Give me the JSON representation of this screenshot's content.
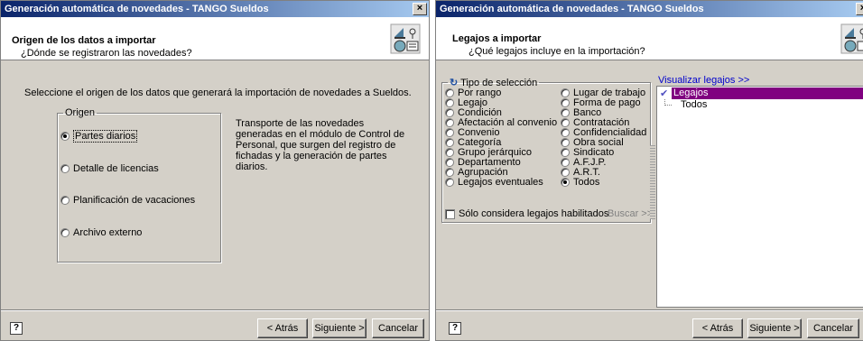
{
  "left_window": {
    "title": "Generación automática de novedades - TANGO Sueldos",
    "close_label": "×",
    "header_title": "Origen de los datos a importar",
    "header_subtitle": "¿Dónde se registraron las novedades?",
    "instruction": "Seleccione el origen de los datos que generará la importación de novedades a Sueldos.",
    "origin_group_label": "Origen",
    "origin_options": [
      {
        "label": "Partes diarios",
        "selected": true
      },
      {
        "label": "Detalle de licencias",
        "selected": false
      },
      {
        "label": "Planificación de vacaciones",
        "selected": false
      },
      {
        "label": "Archivo externo",
        "selected": false
      }
    ],
    "description": "Transporte de las novedades generadas en el módulo de Control de Personal, que surgen del registro de fichadas y la generación de partes diarios.",
    "help_label": "?",
    "buttons": {
      "back": "< Atrás",
      "next": "Siguiente >",
      "cancel": "Cancelar"
    }
  },
  "right_window": {
    "title": "Generación automática de novedades - TANGO Sueldos",
    "header_title": "Legajos a importar",
    "header_subtitle": "¿Qué legajos incluye en la importación?",
    "selection_group_label": "Tipo de selección",
    "selection_col1": [
      {
        "label": "Por rango",
        "selected": false
      },
      {
        "label": "Legajo",
        "selected": false
      },
      {
        "label": "Condición",
        "selected": false
      },
      {
        "label": "Afectación al convenio",
        "selected": false
      },
      {
        "label": "Convenio",
        "selected": false
      },
      {
        "label": "Categoría",
        "selected": false
      },
      {
        "label": "Grupo jerárquico",
        "selected": false
      },
      {
        "label": "Departamento",
        "selected": false
      },
      {
        "label": "Agrupación",
        "selected": false
      },
      {
        "label": "Legajos eventuales",
        "selected": false
      }
    ],
    "selection_col2": [
      {
        "label": "Lugar de trabajo",
        "selected": false
      },
      {
        "label": "Forma de pago",
        "selected": false
      },
      {
        "label": "Banco",
        "selected": false
      },
      {
        "label": "Contratación",
        "selected": false
      },
      {
        "label": "Confidencialidad",
        "selected": false
      },
      {
        "label": "Obra social",
        "selected": false
      },
      {
        "label": "Sindicato",
        "selected": false
      },
      {
        "label": "A.F.J.P.",
        "selected": false
      },
      {
        "label": "A.R.T.",
        "selected": false
      },
      {
        "label": "Todos",
        "selected": true
      }
    ],
    "only_enabled_label": "Sólo considera legajos habilitados",
    "only_enabled_checked": false,
    "search_label": "Buscar >>",
    "view_label": "Visualizar legajos >>",
    "tree_root": "Legajos",
    "tree_child": "Todos",
    "help_label": "?",
    "buttons": {
      "back": "< Atrás",
      "next": "Siguiente >",
      "cancel": "Cancelar"
    }
  }
}
